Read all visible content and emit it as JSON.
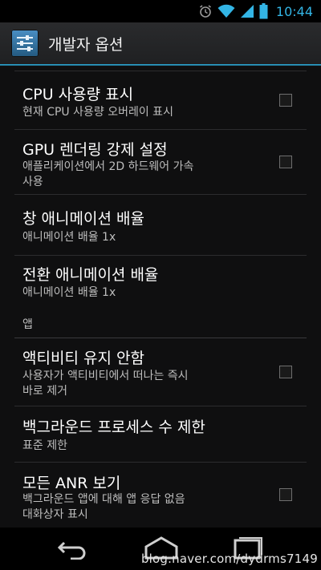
{
  "status_bar": {
    "time": "10:44"
  },
  "action_bar": {
    "title": "개발자 옵션"
  },
  "items": [
    {
      "title": "CPU 사용량 표시",
      "summary": [
        "현재 CPU 사용량 오버레이 표시"
      ],
      "has_checkbox": true,
      "checked": false
    },
    {
      "title": "GPU 렌더링 강제 설정",
      "summary": [
        "애플리케이션에서 2D 하드웨어 가속",
        "사용"
      ],
      "has_checkbox": true,
      "checked": false
    },
    {
      "title": "창 애니메이션 배율",
      "summary": [
        "애니메이션 배율 1x"
      ],
      "has_checkbox": false
    },
    {
      "title": "전환 애니메이션 배율",
      "summary": [
        "애니메이션 배율 1x"
      ],
      "has_checkbox": false
    },
    {
      "title": "액티비티 유지 안함",
      "summary": [
        "사용자가 액티비티에서 떠나는 즉시",
        "바로 제거"
      ],
      "has_checkbox": true,
      "checked": false
    },
    {
      "title": "백그라운드 프로세스 수 제한",
      "summary": [
        "표준 제한"
      ],
      "has_checkbox": false
    },
    {
      "title": "모든 ANR 보기",
      "summary": [
        "백그라운드 앱에 대해 앱 응답 없음",
        "대화상자 표시"
      ],
      "has_checkbox": true,
      "checked": false
    }
  ],
  "section_header": "앱",
  "watermark": "blog.naver.com/dydrms7149",
  "colors": {
    "accent": "#33b5e5",
    "background": "#0f0f10",
    "divider": "#2c2c2e"
  }
}
